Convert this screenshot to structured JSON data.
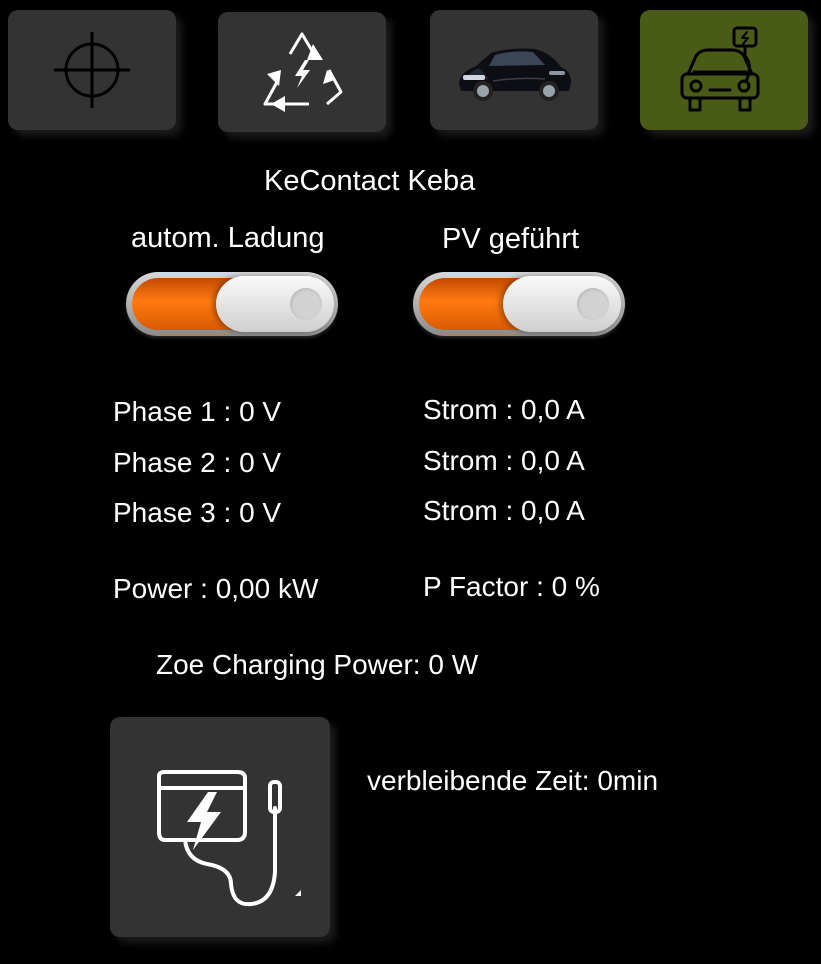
{
  "nav": {
    "tabs": [
      {
        "icon": "crosshair-icon"
      },
      {
        "icon": "recycle-energy-icon"
      },
      {
        "icon": "car-photo"
      },
      {
        "icon": "car-charger-icon",
        "active": true
      }
    ],
    "active_color": "#4a5a17"
  },
  "device": {
    "title": "KeContact Keba"
  },
  "toggles": {
    "auto_label": "autom. Ladung",
    "pv_label": "PV geführt",
    "accent_color": "#ff7a10"
  },
  "phases": [
    {
      "label": "Phase 1 : 0 V",
      "current": "Strom : 0,0 A"
    },
    {
      "label": "Phase 2 : 0 V",
      "current": "Strom : 0,0 A"
    },
    {
      "label": "Phase 3 : 0 V",
      "current": "Strom : 0,0 A"
    }
  ],
  "power": {
    "total": "Power : 0,00 kW",
    "factor": "P Factor : 0 %"
  },
  "zoe": {
    "charging_power": "Zoe Charging Power: 0 W"
  },
  "charge": {
    "icon": "charging-plug-icon",
    "remaining": "verbleibende Zeit: 0min"
  }
}
